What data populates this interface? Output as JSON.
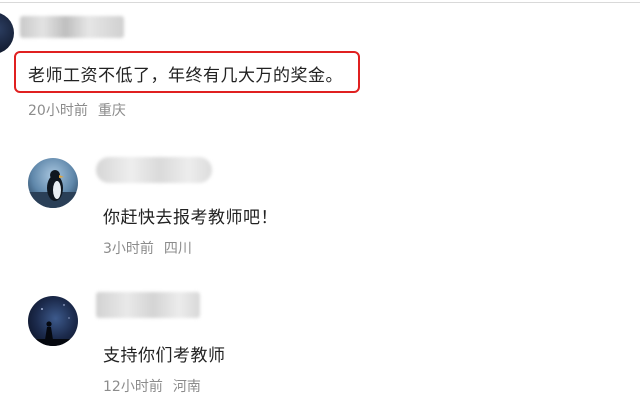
{
  "comments": [
    {
      "text": "老师工资不低了，年终有几大万的奖金。",
      "time": "20小时前",
      "location": "重庆",
      "highlighted": true
    },
    {
      "text": "你赶快去报考教师吧！",
      "time": "3小时前",
      "location": "四川",
      "is_reply": true
    },
    {
      "text": "支持你们考教师",
      "time": "12小时前",
      "location": "河南",
      "is_reply": true
    }
  ],
  "colors": {
    "highlight_border": "#e02020",
    "meta_text": "#8c8c8c",
    "comment_text": "#222222"
  }
}
